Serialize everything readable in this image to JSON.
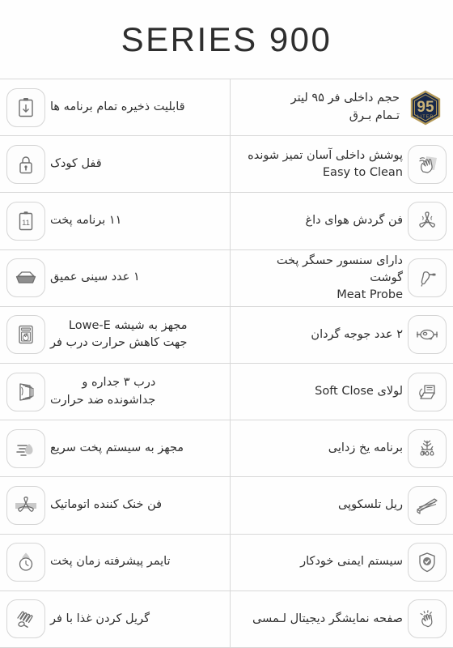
{
  "header": {
    "title": "SERIES 900"
  },
  "badge": {
    "number": "95",
    "unit": "LITER",
    "fill_color": "#17284a",
    "border_color": "#b49a59",
    "text_color": "#c9b277"
  },
  "colors": {
    "background": "#ffffff",
    "divider": "#d8d8d8",
    "text": "#2f2f2f",
    "icon_stroke": "#6e6e6e",
    "icon_frame": "#d5d5d5"
  },
  "rows": [
    {
      "right": {
        "icon": "95-liter-badge-icon",
        "text": "حجم داخلی فر ۹۵ لیتر\nتـمام بـرق"
      },
      "left": {
        "icon": "clipboard-download-icon",
        "text": "قابلیت ذخیره تمام برنامه ها"
      }
    },
    {
      "right": {
        "icon": "cleaning-hand-icon",
        "text": "پوشش داخلی آسان تمیز شونده\nEasy to Clean"
      },
      "left": {
        "icon": "padlock-icon",
        "text": "قفل کودک"
      }
    },
    {
      "right": {
        "icon": "hot-air-fan-icon",
        "text": "فن گردش هوای داغ"
      },
      "left": {
        "icon": "clipboard-11-icon",
        "text": "۱۱ برنامه پخت"
      }
    },
    {
      "right": {
        "icon": "meat-probe-icon",
        "text": "دارای سنسور حسگر پخت گوشت\nMeat Probe"
      },
      "left": {
        "icon": "deep-tray-icon",
        "text": "۱ عدد سینی عمیق"
      }
    },
    {
      "right": {
        "icon": "rotisserie-chicken-icon",
        "text": "۲ عدد جوجه گردان"
      },
      "left": {
        "icon": "oven-glass-door-icon",
        "text": "مجهز به شیشه  Lowe-E\nجهت کاهش حرارت درب فر"
      }
    },
    {
      "right": {
        "icon": "soft-close-hinge-icon",
        "text": "لولای Soft Close"
      },
      "left": {
        "icon": "triple-glazed-door-icon",
        "text": "درب ۳ جداره و\nجداشونده ضد حرارت"
      }
    },
    {
      "right": {
        "icon": "defrost-icon",
        "text": "برنامه یخ زدایی"
      },
      "left": {
        "icon": "fast-cook-icon",
        "text": "مجهز به سیستم پخت سریع"
      }
    },
    {
      "right": {
        "icon": "telescopic-rail-icon",
        "text": "ریل تلسکوپی"
      },
      "left": {
        "icon": "cooling-fan-icon",
        "text": "فن خنک کننده اتوماتیک"
      }
    },
    {
      "right": {
        "icon": "safety-shield-icon",
        "text": "سیستم ایمنی خودکار"
      },
      "left": {
        "icon": "cooking-timer-icon",
        "text": "تایمر پیشرفته زمان پخت"
      }
    },
    {
      "right": {
        "icon": "touch-display-icon",
        "text": "صفحه نمایشگر دیجیتال لـمسی"
      },
      "left": {
        "icon": "grill-element-icon",
        "text": "گریل کردن غذا با فر"
      }
    }
  ]
}
